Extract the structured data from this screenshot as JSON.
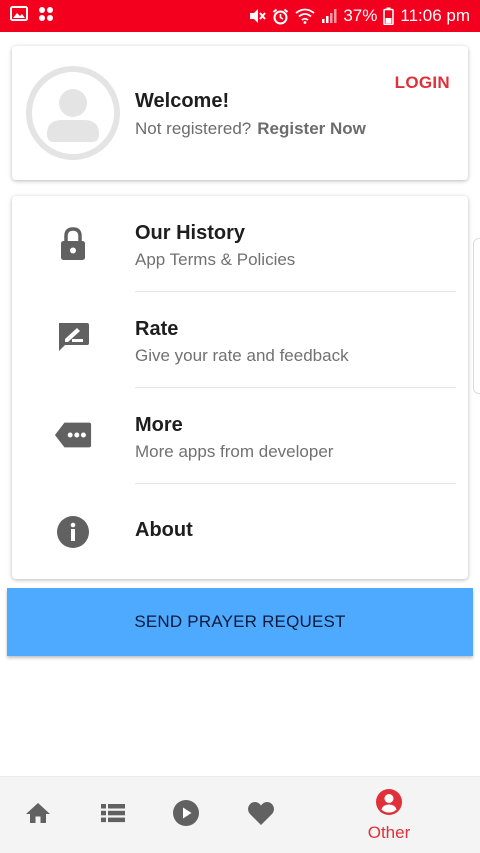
{
  "status_bar": {
    "battery": "37%",
    "time": "11:06 pm",
    "background_color": "#f2001d"
  },
  "profile": {
    "welcome": "Welcome!",
    "not_registered": "Not registered?",
    "register_link": "Register Now",
    "login": "LOGIN",
    "avatar_icon": "user-placeholder-icon"
  },
  "menu": {
    "items": [
      {
        "title": "Our History",
        "subtitle": "App Terms & Policies",
        "icon": "lock-icon"
      },
      {
        "title": "Rate",
        "subtitle": "Give your rate and feedback",
        "icon": "rate-feedback-icon"
      },
      {
        "title": "More",
        "subtitle": "More apps from developer",
        "icon": "more-tag-icon"
      },
      {
        "title": "About",
        "subtitle": "",
        "icon": "info-icon"
      }
    ]
  },
  "prayer_button": {
    "label": "SEND PRAYER REQUEST",
    "color": "#4eaaff"
  },
  "bottom_nav": {
    "items": [
      {
        "icon": "home-icon",
        "label": ""
      },
      {
        "icon": "list-icon",
        "label": ""
      },
      {
        "icon": "play-icon",
        "label": ""
      },
      {
        "icon": "heart-icon",
        "label": ""
      },
      {
        "icon": "account-icon",
        "label": "Other",
        "active": true
      }
    ],
    "active_color": "#e0303a",
    "inactive_color": "#616161"
  }
}
